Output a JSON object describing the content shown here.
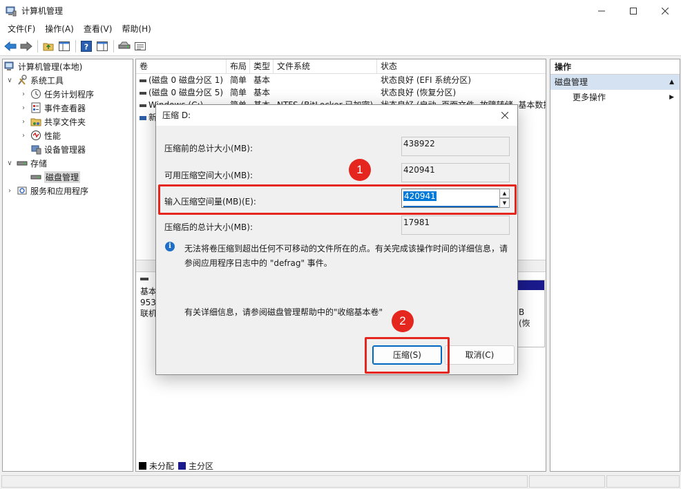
{
  "window": {
    "title": "计算机管理"
  },
  "menu": [
    "文件(F)",
    "操作(A)",
    "查看(V)",
    "帮助(H)"
  ],
  "tree": {
    "root": "计算机管理(本地)",
    "system_tools": "系统工具",
    "task_scheduler": "任务计划程序",
    "event_viewer": "事件查看器",
    "shared_folders": "共享文件夹",
    "performance": "性能",
    "device_manager": "设备管理器",
    "storage": "存储",
    "disk_management": "磁盘管理",
    "services_apps": "服务和应用程序"
  },
  "volumes": {
    "columns": [
      "卷",
      "布局",
      "类型",
      "文件系统",
      "状态"
    ],
    "rows": [
      {
        "name": "(磁盘 0 磁盘分区 1)",
        "layout": "简单",
        "type": "基本",
        "fs": "",
        "status": "状态良好 (EFI 系统分区)"
      },
      {
        "name": "(磁盘 0 磁盘分区 5)",
        "layout": "简单",
        "type": "基本",
        "fs": "",
        "status": "状态良好 (恢复分区)"
      },
      {
        "name": "Windows (C:)",
        "layout": "简单",
        "type": "基本",
        "fs": "NTFS (BitLocker 已加密)",
        "status": "状态良好 (启动, 页面文件, 故障转储, 基本数据分区)"
      },
      {
        "name": "新",
        "layout": "",
        "type": "",
        "fs": "",
        "status": ""
      }
    ]
  },
  "disk_info": {
    "type_text": "基本",
    "size_text": "953",
    "status_text": "联机",
    "right_size": "B",
    "right_status": "(恢"
  },
  "legend": {
    "unallocated": "未分配",
    "primary": "主分区"
  },
  "actions": {
    "title": "操作",
    "section": "磁盘管理",
    "more": "更多操作"
  },
  "dialog": {
    "title": "压缩 D:",
    "total_before_label": "压缩前的总计大小(MB):",
    "total_before_value": "438922",
    "available_label": "可用压缩空间大小(MB):",
    "available_value": "420941",
    "input_label": "输入压缩空间量(MB)(E):",
    "input_value": "420941",
    "total_after_label": "压缩后的总计大小(MB):",
    "total_after_value": "17981",
    "info_text": "无法将卷压缩到超出任何不可移动的文件所在的点。有关完成该操作时间的详细信息，请参阅应用程序日志中的 \"defrag\" 事件。",
    "help_text": "有关详细信息，请参阅磁盘管理帮助中的\"收缩基本卷\"",
    "shrink_button": "压缩(S)",
    "cancel_button": "取消(C)"
  },
  "annotations": {
    "step1": "1",
    "step2": "2",
    "highlight_color": "#e5261f"
  }
}
